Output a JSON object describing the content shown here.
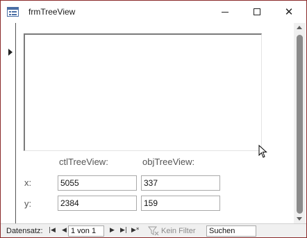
{
  "window": {
    "title": "frmTreeView",
    "icon": "form-icon",
    "buttons": {
      "minimize_icon": "minimize-icon",
      "maximize_icon": "maximize-icon",
      "close_icon": "close-icon"
    }
  },
  "form": {
    "labels": {
      "ctl": "ctlTreeView:",
      "obj": "objTreeView:",
      "x": "x:",
      "y": "y:"
    },
    "values": {
      "ctl_x": "5055",
      "obj_x": "337",
      "ctl_y": "2384",
      "obj_y": "159"
    }
  },
  "navigation": {
    "record_label": "Datensatz:",
    "first_glyph": "|◀",
    "prev_glyph": "◀",
    "position": "1 von 1",
    "next_glyph": "▶",
    "last_glyph": "▶|",
    "new_glyph": "▶*",
    "filter_label": "Kein Filter",
    "search_value": "Suchen"
  },
  "colors": {
    "window_border": "#8a2a2a",
    "nav_background": "#f0f0f0",
    "label_text": "#555555"
  }
}
